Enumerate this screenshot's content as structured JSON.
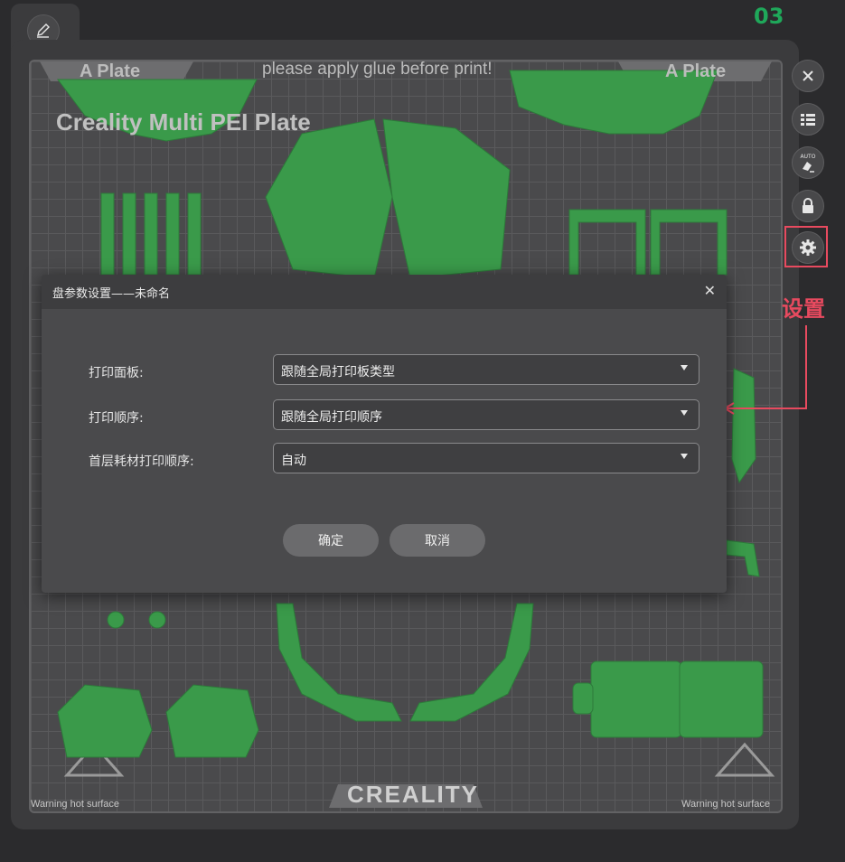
{
  "plate": {
    "step_number": "03",
    "tab_left_label": "A Plate",
    "tab_right_label": "A Plate",
    "glue_notice": "please apply glue before print!",
    "plate_name": "Creality Multi PEI Plate",
    "warning_left": "Warning hot surface",
    "warning_right": "Warning hot surface",
    "brand": "CREALITY"
  },
  "sidebar": {
    "close_icon": "close-icon",
    "list_icon": "list-icon",
    "auto_icon": "auto-arrange-icon",
    "lock_icon": "lock-icon",
    "settings_icon": "gear-icon",
    "auto_label": "AUTO"
  },
  "annotation": {
    "label": "设置",
    "color": "#e84a5f"
  },
  "dialog": {
    "title": "盘参数设置——未命名",
    "rows": [
      {
        "label": "打印面板:",
        "value": "跟随全局打印板类型"
      },
      {
        "label": "打印顺序:",
        "value": "跟随全局打印顺序"
      },
      {
        "label": "首层耗材打印顺序:",
        "value": "自动"
      }
    ],
    "ok_label": "确定",
    "cancel_label": "取消"
  },
  "colors": {
    "model_green": "#3a9a4a",
    "step_green": "#1fa85a",
    "background": "#2b2b2d"
  }
}
